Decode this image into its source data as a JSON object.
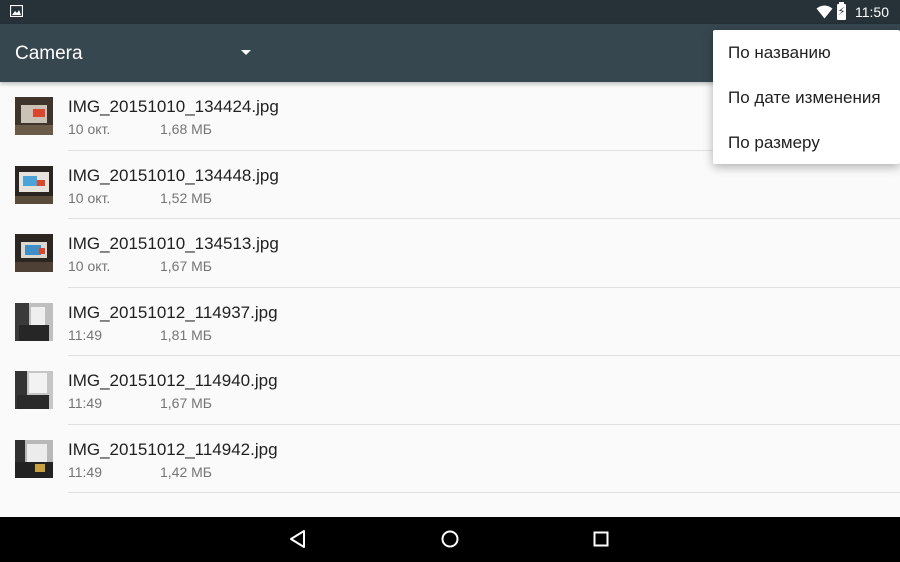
{
  "status_bar": {
    "time": "11:50",
    "battery_label": "⚡",
    "icons": [
      "gallery-notification-icon",
      "wifi-icon",
      "battery-charging-icon"
    ]
  },
  "toolbar": {
    "title": "Camera"
  },
  "files": [
    {
      "name": "IMG_20151010_134424.jpg",
      "date": "10 окт.",
      "size": "1,68 МБ"
    },
    {
      "name": "IMG_20151010_134448.jpg",
      "date": "10 окт.",
      "size": "1,52 МБ"
    },
    {
      "name": "IMG_20151010_134513.jpg",
      "date": "10 окт.",
      "size": "1,67 МБ"
    },
    {
      "name": "IMG_20151012_114937.jpg",
      "date": "11:49",
      "size": "1,81 МБ"
    },
    {
      "name": "IMG_20151012_114940.jpg",
      "date": "11:49",
      "size": "1,67 МБ"
    },
    {
      "name": "IMG_20151012_114942.jpg",
      "date": "11:49",
      "size": "1,42 МБ"
    }
  ],
  "sort_menu": {
    "items": [
      "По названию",
      "По дате изменения",
      "По размеру"
    ]
  },
  "nav_bar": {
    "icons": [
      "back-icon",
      "home-icon",
      "recents-icon"
    ]
  },
  "colors": {
    "status_bar": "#263238",
    "toolbar": "#37474f",
    "background": "#fafafa",
    "nav_bar": "#000000"
  }
}
